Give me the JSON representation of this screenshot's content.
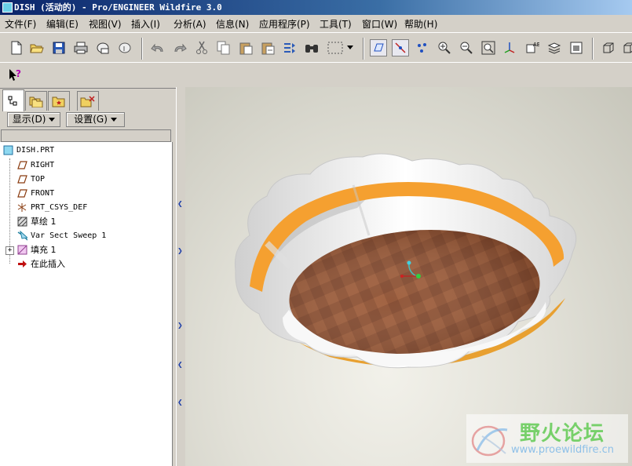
{
  "window": {
    "title": "DISH (活动的) - Pro/ENGINEER Wildfire 3.0"
  },
  "menu": [
    {
      "label": "文件(F)"
    },
    {
      "label": "编辑(E)"
    },
    {
      "label": "视图(V)"
    },
    {
      "label": "插入(I)"
    },
    {
      "label": "分析(A)"
    },
    {
      "label": "信息(N)"
    },
    {
      "label": "应用程序(P)"
    },
    {
      "label": "工具(T)"
    },
    {
      "label": "窗口(W)"
    },
    {
      "label": "帮助(H)"
    }
  ],
  "model_tree": {
    "show_button": "显示(D)",
    "settings_button": "设置(G)",
    "root": "DISH.PRT",
    "items": [
      {
        "label": "RIGHT",
        "icon": "datum-plane-icon"
      },
      {
        "label": "TOP",
        "icon": "datum-plane-icon"
      },
      {
        "label": "FRONT",
        "icon": "datum-plane-icon"
      },
      {
        "label": "PRT_CSYS_DEF",
        "icon": "csys-icon"
      },
      {
        "label": "草绘 1",
        "icon": "sketch-icon"
      },
      {
        "label": "Var Sect Sweep 1",
        "icon": "sweep-icon"
      },
      {
        "label": "填充 1",
        "icon": "fill-icon"
      },
      {
        "label": "在此插入",
        "icon": "insert-here-arrow-icon"
      }
    ]
  },
  "watermark": {
    "text": "野火论坛",
    "url": "www.proewildfire.cn"
  },
  "colors": {
    "title_gradient_start": "#0a246a",
    "dish_orange": "#f5a030",
    "dish_brown": "#8a4a2a"
  }
}
